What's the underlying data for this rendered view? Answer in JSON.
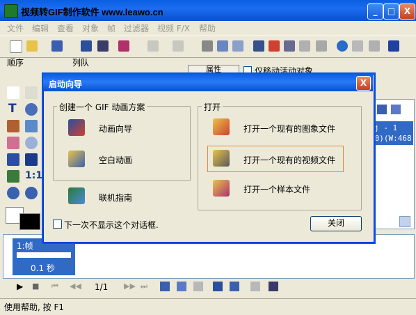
{
  "app": {
    "title": "视频转GIF制作软件 www.leawo.cn"
  },
  "window_buttons": {
    "minimize": "_",
    "maximize": "□",
    "close": "X"
  },
  "menu": [
    "文件",
    "编辑",
    "查看",
    "对象",
    "帧",
    "过滤器",
    "视频 F/X",
    "帮助"
  ],
  "labels": {
    "order": "顺序",
    "queue": "列队",
    "properties": "属性",
    "only_move": "仅移动活动对象"
  },
  "right_panel": {
    "line1": "j - 1",
    "line2": ".0)(W:468"
  },
  "frames": {
    "frame_label": "1:帧",
    "frame_time": "0.1 秒",
    "page": "1/1"
  },
  "status": {
    "text": "使用帮助, 按 F1"
  },
  "dialog": {
    "title": "启动向导",
    "close_x": "X",
    "create_group": "创建一个 GIF 动画方案",
    "open_group": "打开",
    "animation_wizard": "动画向导",
    "blank_animation": "空白动画",
    "online_guide": "联机指南",
    "open_image": "打开一个现有的图象文件",
    "open_video": "打开一个现有的视频文件",
    "open_sample": "打开一个样本文件",
    "dont_show": "下一次不显示这个对话框.",
    "close_button": "关闭"
  },
  "palette_labels": {
    "text_tool": "T",
    "ratio": "1:1"
  }
}
